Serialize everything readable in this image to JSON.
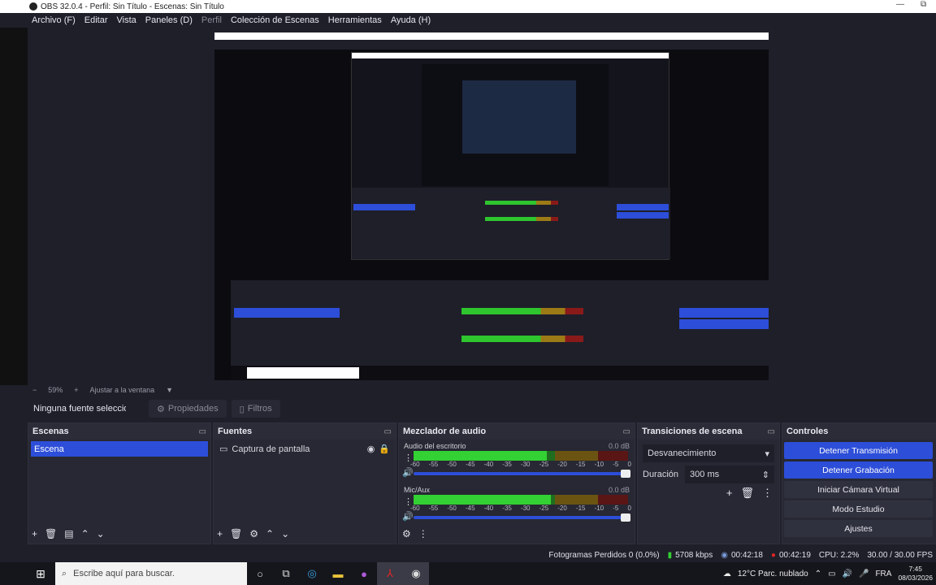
{
  "window": {
    "title": "OBS 32.0.4 - Perfil: Sin Título - Escenas: Sin Título",
    "min": "—",
    "restore": "⧉"
  },
  "menu": [
    "Archivo (F)",
    "Editar",
    "Vista",
    "Paneles (D)",
    "Perfil",
    "Colección de Escenas",
    "Herramientas",
    "Ayuda (H)"
  ],
  "zoom": {
    "minus": "−",
    "value": "59%",
    "plus": "+",
    "fit": "Ajustar a la ventana",
    "caret": "▼"
  },
  "source_bar": {
    "no_source": "Ninguna fuente seleccionada",
    "properties": "Propiedades",
    "filters": "Filtros"
  },
  "scenes": {
    "title": "Escenas",
    "items": [
      "Escena"
    ]
  },
  "sources": {
    "title": "Fuentes",
    "items": [
      "Captura de pantalla"
    ]
  },
  "mixer": {
    "title": "Mezclador de audio",
    "channels": [
      {
        "name": "Audio del escritorio",
        "db": "0.0 dB",
        "level": 0.62
      },
      {
        "name": "Mic/Aux",
        "db": "0.0 dB",
        "level": 0.64
      }
    ],
    "ticks": [
      "-60",
      "-55",
      "-50",
      "-45",
      "-40",
      "-35",
      "-30",
      "-25",
      "-20",
      "-15",
      "-10",
      "-5",
      "0"
    ]
  },
  "transitions": {
    "title": "Transiciones de escena",
    "selected": "Desvanecimiento",
    "duration_label": "Duración",
    "duration": "300 ms"
  },
  "controls": {
    "title": "Controles",
    "buttons": [
      "Detener Transmisión",
      "Detener Grabación",
      "Iniciar Cámara Virtual",
      "Modo Estudio",
      "Ajustes"
    ]
  },
  "status": {
    "dropped": "Fotogramas Perdidos 0 (0.0%)",
    "kbps": "5708 kbps",
    "stream_time": "00:42:18",
    "rec_time": "00:42:19",
    "cpu": "CPU: 2.2%",
    "fps": "30.00 / 30.00 FPS"
  },
  "taskbar": {
    "search": "Escribe aquí para buscar.",
    "weather": "12°C  Parc. nublado",
    "lang": "FRA",
    "time": "7:45",
    "date": "08/03/2026"
  },
  "colors": {
    "accent": "#2d4ed8",
    "rec": "#e02424",
    "meter_green": "#33d133"
  }
}
